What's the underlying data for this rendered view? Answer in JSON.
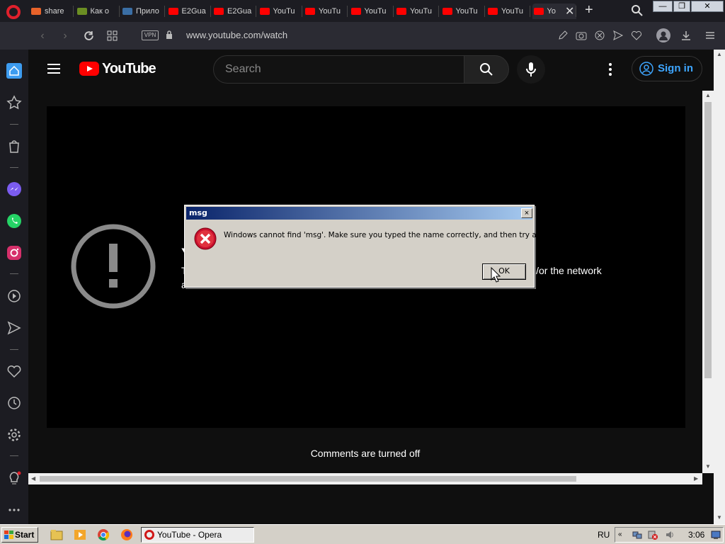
{
  "browser": {
    "tabs": [
      {
        "label": "share",
        "color": "#e8632a"
      },
      {
        "label": "Как о",
        "color": "#6b8e23"
      },
      {
        "label": "Прило",
        "color": "#3a6ea5"
      },
      {
        "label": "E2Gua",
        "color": "#ff0000"
      },
      {
        "label": "E2Gua",
        "color": "#ff0000"
      },
      {
        "label": "YouTu",
        "color": "#ff0000"
      },
      {
        "label": "YouTu",
        "color": "#ff0000"
      },
      {
        "label": "YouTu",
        "color": "#ff0000"
      },
      {
        "label": "YouTu",
        "color": "#ff0000"
      },
      {
        "label": "YouTu",
        "color": "#ff0000"
      },
      {
        "label": "YouTu",
        "color": "#ff0000"
      },
      {
        "label": "Yo",
        "color": "#ff0000",
        "active": true
      }
    ],
    "vpn_label": "VPN",
    "url": "www.youtube.com/watch",
    "window_buttons": {
      "minimize": "—",
      "restore": "❐",
      "close": "✕"
    }
  },
  "youtube": {
    "logo_text": "YouTube",
    "search_placeholder": "Search",
    "signin_label": "Sign in",
    "player_title": "Y",
    "player_line1": "T",
    "player_line1_tail": "l/or the network",
    "player_line2": "a",
    "comments_text": "Comments are turned off"
  },
  "dialog": {
    "title": "msg",
    "close_label": "×",
    "message": "Windows cannot find 'msg'. Make sure you typed the name correctly, and then try again.",
    "ok_label": "OK"
  },
  "taskbar": {
    "start_label": "Start",
    "task_label": "YouTube - Opera",
    "language": "RU",
    "time": "3:06"
  },
  "colors": {
    "youtube_red": "#ff0000",
    "link_blue": "#3ea6ff",
    "dialog_face": "#d4d0c8",
    "titlebar_start": "#0a246a"
  }
}
